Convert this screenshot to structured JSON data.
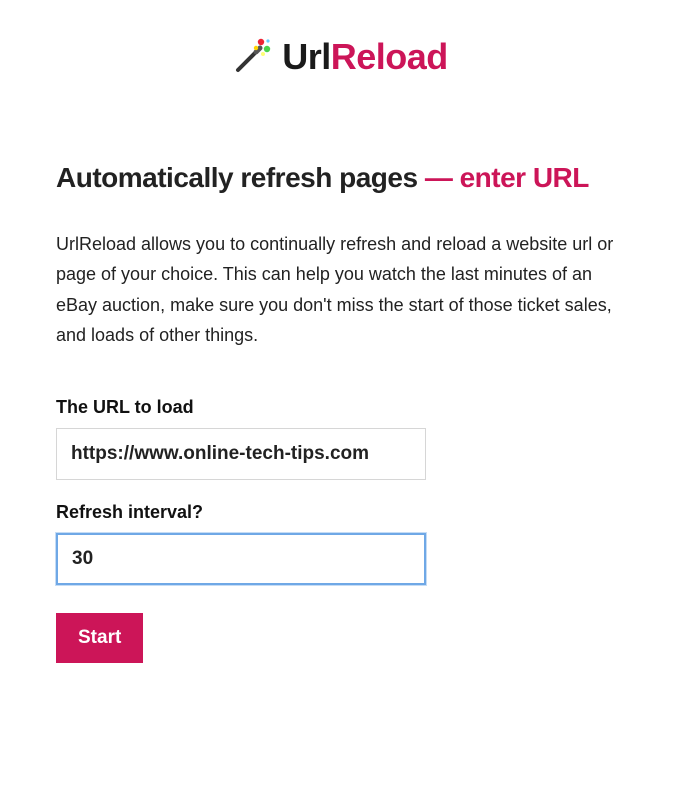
{
  "brand": {
    "name_first": "Url",
    "name_second": "Reload"
  },
  "headline": {
    "main": "Automatically refresh pages ",
    "accent": "— enter URL"
  },
  "description": "UrlReload allows you to continually refresh and reload a website url or page of your choice. This can help you watch the last minutes of an eBay auction, make sure you don't miss the start of those ticket sales, and loads of other things.",
  "form": {
    "url_label": "The URL to load",
    "url_value": "https://www.online-tech-tips.com",
    "interval_label": "Refresh interval?",
    "interval_value": "30",
    "start_label": "Start"
  },
  "colors": {
    "accent": "#cc1558"
  }
}
